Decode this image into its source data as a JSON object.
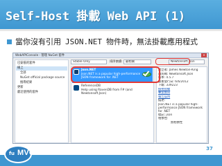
{
  "slide": {
    "title": "Self-Host 掛載 Web API (1)",
    "bullet_prefix": "當你沒有引用",
    "bullet_code": "JSON.NET",
    "bullet_suffix": "物件時，無法掛載應用程式",
    "page_number": "37",
    "logo_text": "MVC",
    "logo_small": "fu"
  },
  "nuget_window": {
    "caption": "WebAPIConsole - 管理 NuGet 套件",
    "left_pane": {
      "items": [
        "已安裝的套件",
        "線上",
        "全部",
        "NuGet official package source",
        "搜尋結果",
        "更新",
        "最近使用的套件"
      ],
      "selected": 1
    },
    "toolbar": {
      "filter": "Stable Only",
      "sort_label": "排序依據:",
      "sort_value": "最相關",
      "search_value": "Newtonsoft.Json"
    },
    "packages": [
      {
        "name": "Json.NET",
        "description": "Json.NET is a popular high-performance JSON framework for .NET",
        "selected": true
      },
      {
        "name": "ReferenceDB",
        "description": "Help using RavenDB from F# (and Newtonsoft.Json)",
        "selected": false
      }
    ],
    "details": {
      "author": "建立者: James Newton-King",
      "id": "識別碼: Newtonsoft.Json",
      "version": "版本: 4.5.7",
      "published": "最後發行日: 6/6/2012",
      "downloads": "下載: 339223",
      "license_link": "檢視授權",
      "project_link": "專案資訊",
      "report_link": "報告誤用",
      "desc_label": "描述:",
      "desc_text": "Json.NET is a popular high-performance JSON framework for .NET",
      "tags_label": "標記: json",
      "deps_label": "相依性:",
      "deps_value": "無相依性"
    }
  }
}
